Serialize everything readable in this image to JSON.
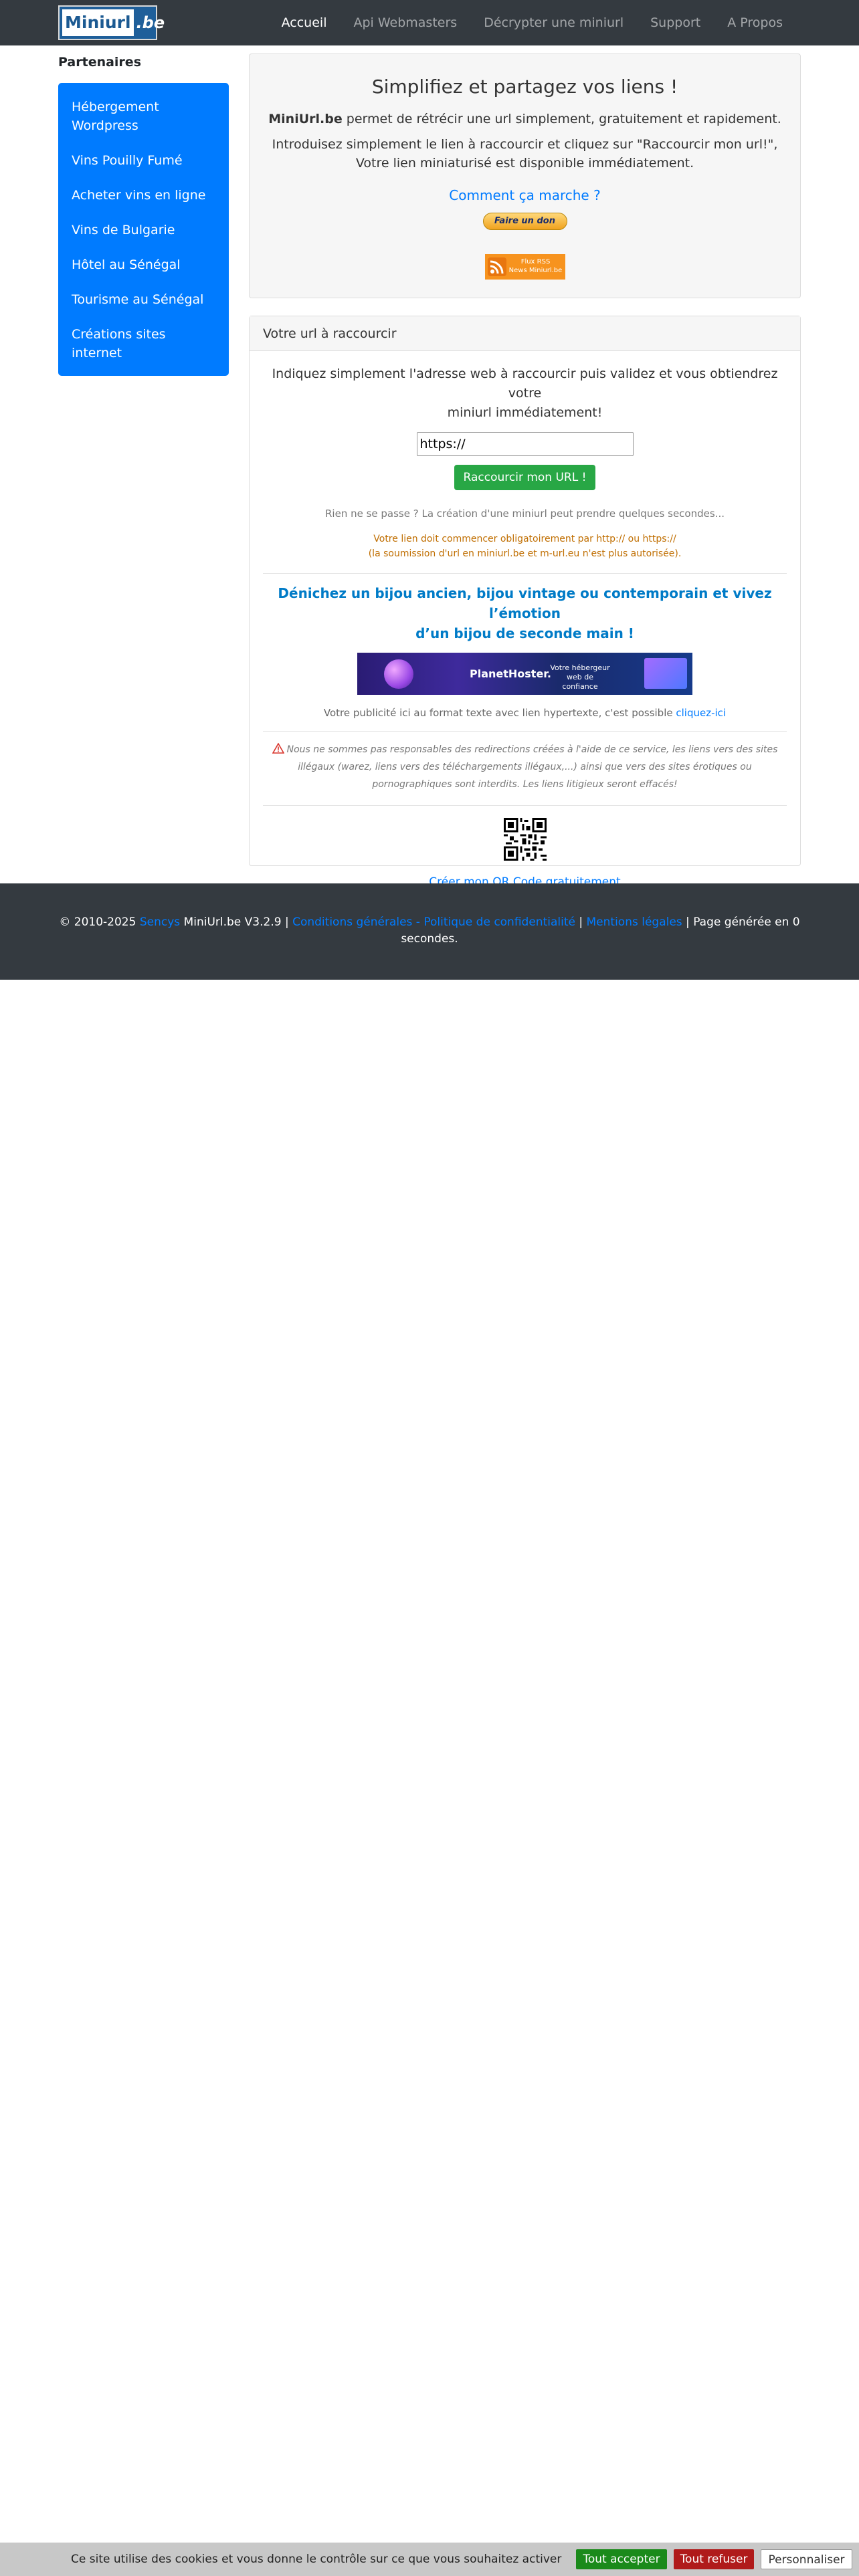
{
  "logo": {
    "left": "Miniurl",
    "right": ".be"
  },
  "nav": {
    "items": [
      "Accueil",
      "Api Webmasters",
      "Décrypter une miniurl",
      "Support",
      "A Propos"
    ]
  },
  "sidebar": {
    "title": "Partenaires",
    "items": [
      "Hébergement Wordpress",
      "Vins Pouilly Fumé",
      "Acheter vins en ligne",
      "Vins de Bulgarie",
      "Hôtel au Sénégal",
      "Tourisme au Sénégal",
      "Créations sites internet"
    ]
  },
  "top": {
    "title": "Simplifiez et partagez vos liens !",
    "brand": "MiniUrl.be",
    "desc_rest": " permet de rétrécir une url simplement, gratuitement et rapidement.",
    "desc2_line1": "Introduisez simplement le lien à raccourcir et cliquez sur \"Raccourcir mon url!\",",
    "desc2_line2": "Votre lien miniaturisé est disponible immédiatement.",
    "howto": "Comment ça marche ?",
    "donate": "Faire un don",
    "rss_line1": "Flux RSS",
    "rss_line2": "News Miniurl.be"
  },
  "main": {
    "header": "Votre url à raccourcir",
    "intro_line1": "Indiquez simplement l'adresse web à raccourcir puis validez et vous obtiendrez votre",
    "intro_line2": "miniurl immédiatement!",
    "input_value": "https://",
    "submit": "Raccourcir mon URL !",
    "wait": "Rien ne se passe ? La création d'une miniurl peut prendre quelques secondes...",
    "warn_line1": "Votre lien doit commencer obligatoirement par http:// ou https://",
    "warn_line2": "(la soumission d'url en miniurl.be et m-url.eu n'est plus autorisée).",
    "promo_line1": "Dénichez un bijou ancien, bijou vintage ou contemporain et vivez l’émotion",
    "promo_line2": "d’un bijou de seconde main !",
    "banner_brand": "PlanetHoster.",
    "banner_tag": "Votre hébergeur web de confiance",
    "pub_text": "Votre publicité ici au format texte avec lien hypertexte, c'est possible ",
    "pub_link": "cliquez-ici",
    "disclaimer_line1": "Nous ne sommes pas responsables des redirections créées à l'aide de ce service, les liens vers des sites",
    "disclaimer_line2": "illégaux (warez, liens vers des téléchargements illégaux,...) ainsi que vers des sites érotiques ou",
    "disclaimer_line3": "pornographiques sont interdits. Les liens litigieux seront effacés!",
    "qr_link": "Créer mon QR Code gratuitement"
  },
  "footer": {
    "copy": "© 2010-2025 ",
    "company": "Sencys",
    "version": " MiniUrl.be V3.2.9 | ",
    "cgu": "Conditions générales - Politique de confidentialité",
    "sep": " | ",
    "legal": "Mentions légales",
    "generated": " | Page générée en 0 secondes."
  },
  "cookie": {
    "text": "Ce site utilise des cookies et vous donne le contrôle sur ce que vous souhaitez activer",
    "accept": "Tout accepter",
    "refuse": "Tout refuser",
    "custom": "Personnaliser"
  },
  "colors": {
    "navbar": "#343a40",
    "primary": "#007bff",
    "success": "#28a745",
    "warning_text": "#c06e00",
    "promo": "#007bc7"
  }
}
